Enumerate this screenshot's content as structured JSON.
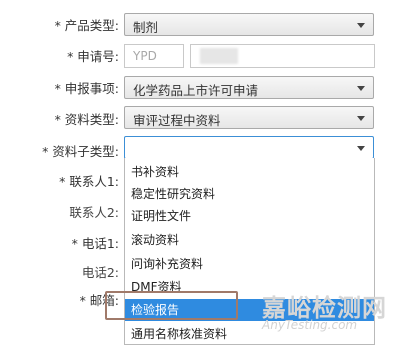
{
  "form": {
    "product_type": {
      "label": "* 产品类型:",
      "value": "制剂"
    },
    "application_no": {
      "label": "* 申请号:",
      "prefix_placeholder": "YPD"
    },
    "declaration_item": {
      "label": "* 申报事项:",
      "value": "化学药品上市许可申请"
    },
    "document_type": {
      "label": "* 资料类型:",
      "value": "审评过程中资料"
    },
    "document_subtype": {
      "label": "* 资料子类型:",
      "value": ""
    },
    "contact1": {
      "label": "* 联系人1:"
    },
    "contact2": {
      "label": "联系人2:"
    },
    "phone1": {
      "label": "* 电话1:"
    },
    "phone2": {
      "label": "电话2:"
    },
    "email": {
      "label": "* 邮箱:"
    }
  },
  "dropdown": {
    "options": [
      "书补资料",
      "稳定性研究资料",
      "证明性文件",
      "滚动资料",
      "问询补充资料",
      "DMF资料",
      "检验报告",
      "通用名称核准资料"
    ],
    "selected_index": 6
  },
  "watermark": {
    "main": "嘉峪检测网",
    "sub": "AnyTesting.com"
  },
  "colors": {
    "dropdown_selected_bg": "#2f8be0",
    "dropdown_open_border": "#3c8fd6",
    "annotation_box": "#a07a6a"
  }
}
